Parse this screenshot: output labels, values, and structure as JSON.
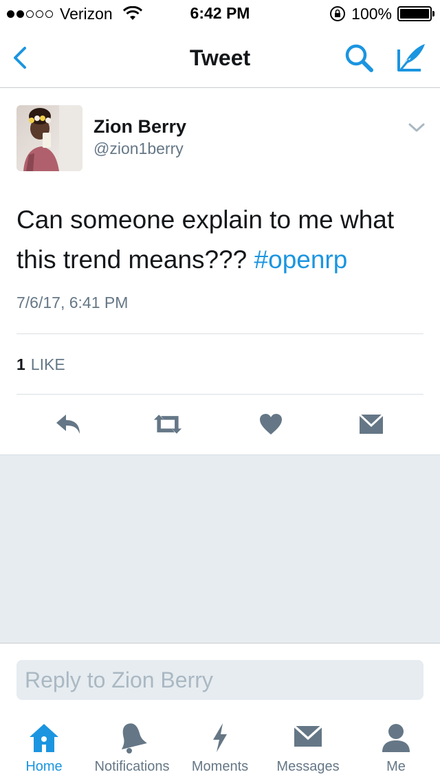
{
  "status_bar": {
    "carrier": "Verizon",
    "time": "6:42 PM",
    "battery": "100%"
  },
  "nav": {
    "title": "Tweet"
  },
  "tweet": {
    "author_name": "Zion Berry",
    "author_handle": "@zion1berry",
    "text": "Can someone explain to me what this trend means???",
    "hashtag": "#openrp",
    "timestamp": "7/6/17, 6:41 PM",
    "likes_count": "1",
    "likes_label": "LIKE"
  },
  "reply": {
    "placeholder": "Reply to Zion Berry"
  },
  "tabs": [
    {
      "label": "Home",
      "icon": "home-icon",
      "active": true
    },
    {
      "label": "Notifications",
      "icon": "bell-icon",
      "active": false
    },
    {
      "label": "Moments",
      "icon": "lightning-icon",
      "active": false
    },
    {
      "label": "Messages",
      "icon": "envelope-icon",
      "active": false
    },
    {
      "label": "Me",
      "icon": "person-icon",
      "active": false
    }
  ],
  "colors": {
    "accent": "#1b95e0",
    "icon_gray": "#657786",
    "background_gray": "#e6ecf0"
  }
}
